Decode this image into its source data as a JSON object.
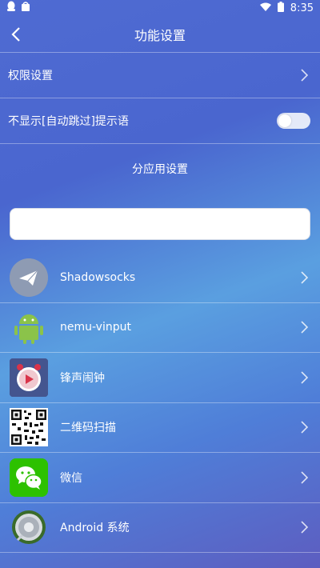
{
  "status": {
    "time": "8:35"
  },
  "header": {
    "title": "功能设置"
  },
  "settings": {
    "permission_label": "权限设置",
    "hide_tip_label": "不显示[自动跳过]提示语",
    "hide_tip_enabled": false
  },
  "per_app": {
    "section_title": "分应用设置"
  },
  "search": {
    "value": "",
    "placeholder": ""
  },
  "apps": [
    {
      "name": "Shadowsocks",
      "icon": "paper-plane-icon"
    },
    {
      "name": "nemu-vinput",
      "icon": "android-robot-icon"
    },
    {
      "name": "锋声闹钟",
      "icon": "alarm-clock-icon"
    },
    {
      "name": "二维码扫描",
      "icon": "qr-code-icon"
    },
    {
      "name": "微信",
      "icon": "wechat-icon"
    },
    {
      "name": "Android 系统",
      "icon": "android-system-icon"
    }
  ],
  "colors": {
    "background_top": "#4f6bd2",
    "background_mid": "#5a9fe0",
    "wechat_green": "#2dc100",
    "android_green": "#8bc34a"
  }
}
